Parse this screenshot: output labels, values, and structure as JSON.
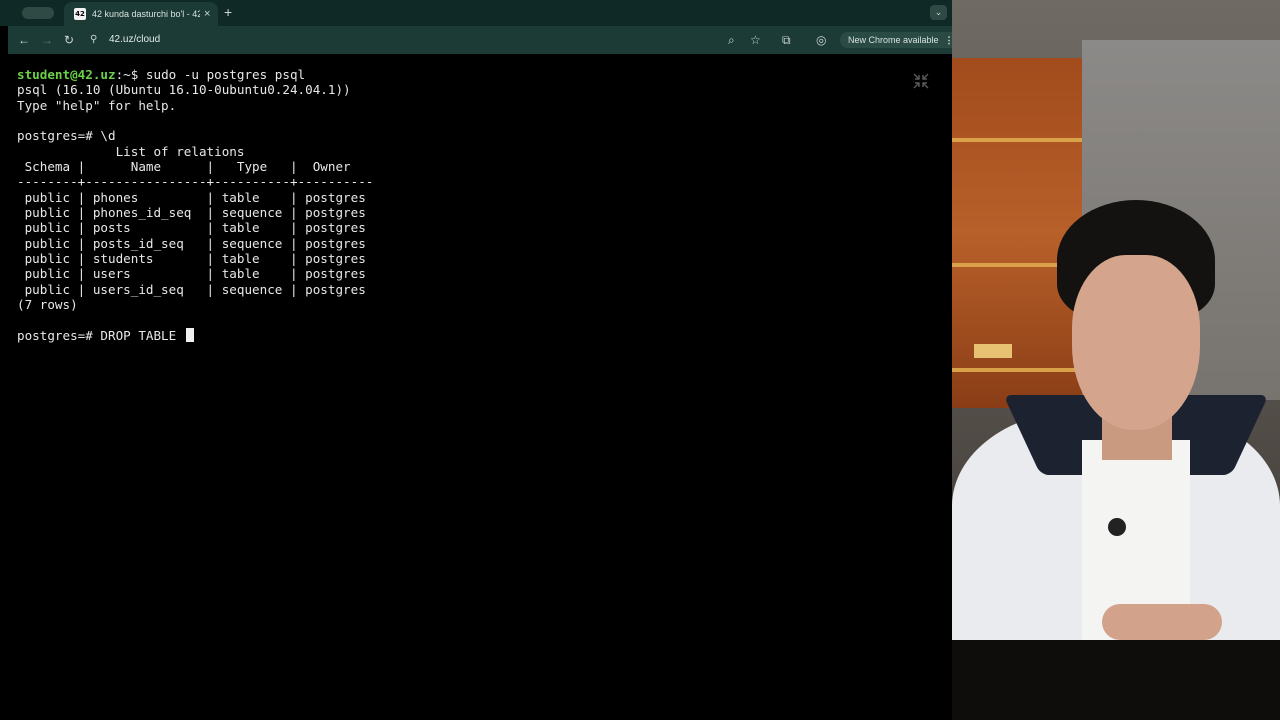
{
  "browser": {
    "tab": {
      "favicon_text": "42",
      "title": "42 kunda dasturchi bo'l - 42",
      "close": "×"
    },
    "newtab": "+",
    "tab_search": "⌄",
    "toolbar": {
      "back": "←",
      "forward": "→",
      "reload": "↻",
      "site_info": "⚲",
      "url": "42.uz/cloud",
      "zoom_icon": "⌕",
      "bookmark_icon": "☆",
      "extensions_icon": "⧉",
      "profile_icon": "◎",
      "update_label": "New Chrome available",
      "menu": "⋮"
    }
  },
  "terminal": {
    "line1": {
      "user": "student@42.uz",
      "rest": ":~$ sudo -u postgres psql"
    },
    "line2": "psql (16.10 (Ubuntu 16.10-0ubuntu0.24.04.1))",
    "line3": "Type \"help\" for help.",
    "line4": "",
    "line5": "postgres=# \\d",
    "table": {
      "title": "             List of relations",
      "header": " Schema |      Name      |   Type   |  Owner",
      "separator": "--------+----------------+----------+----------",
      "rows": [
        " public | phones         | table    | postgres",
        " public | phones_id_seq  | sequence | postgres",
        " public | posts          | table    | postgres",
        " public | posts_id_seq   | sequence | postgres",
        " public | students       | table    | postgres",
        " public | users          | table    | postgres",
        " public | users_id_seq   | sequence | postgres"
      ],
      "footer": "(7 rows)"
    },
    "current_prompt": "postgres=# DROP TABLE "
  },
  "colors": {
    "prompt_user": "#6bd14a",
    "chrome_frame": "#0f2a26",
    "toolbar": "#1d3b36"
  }
}
